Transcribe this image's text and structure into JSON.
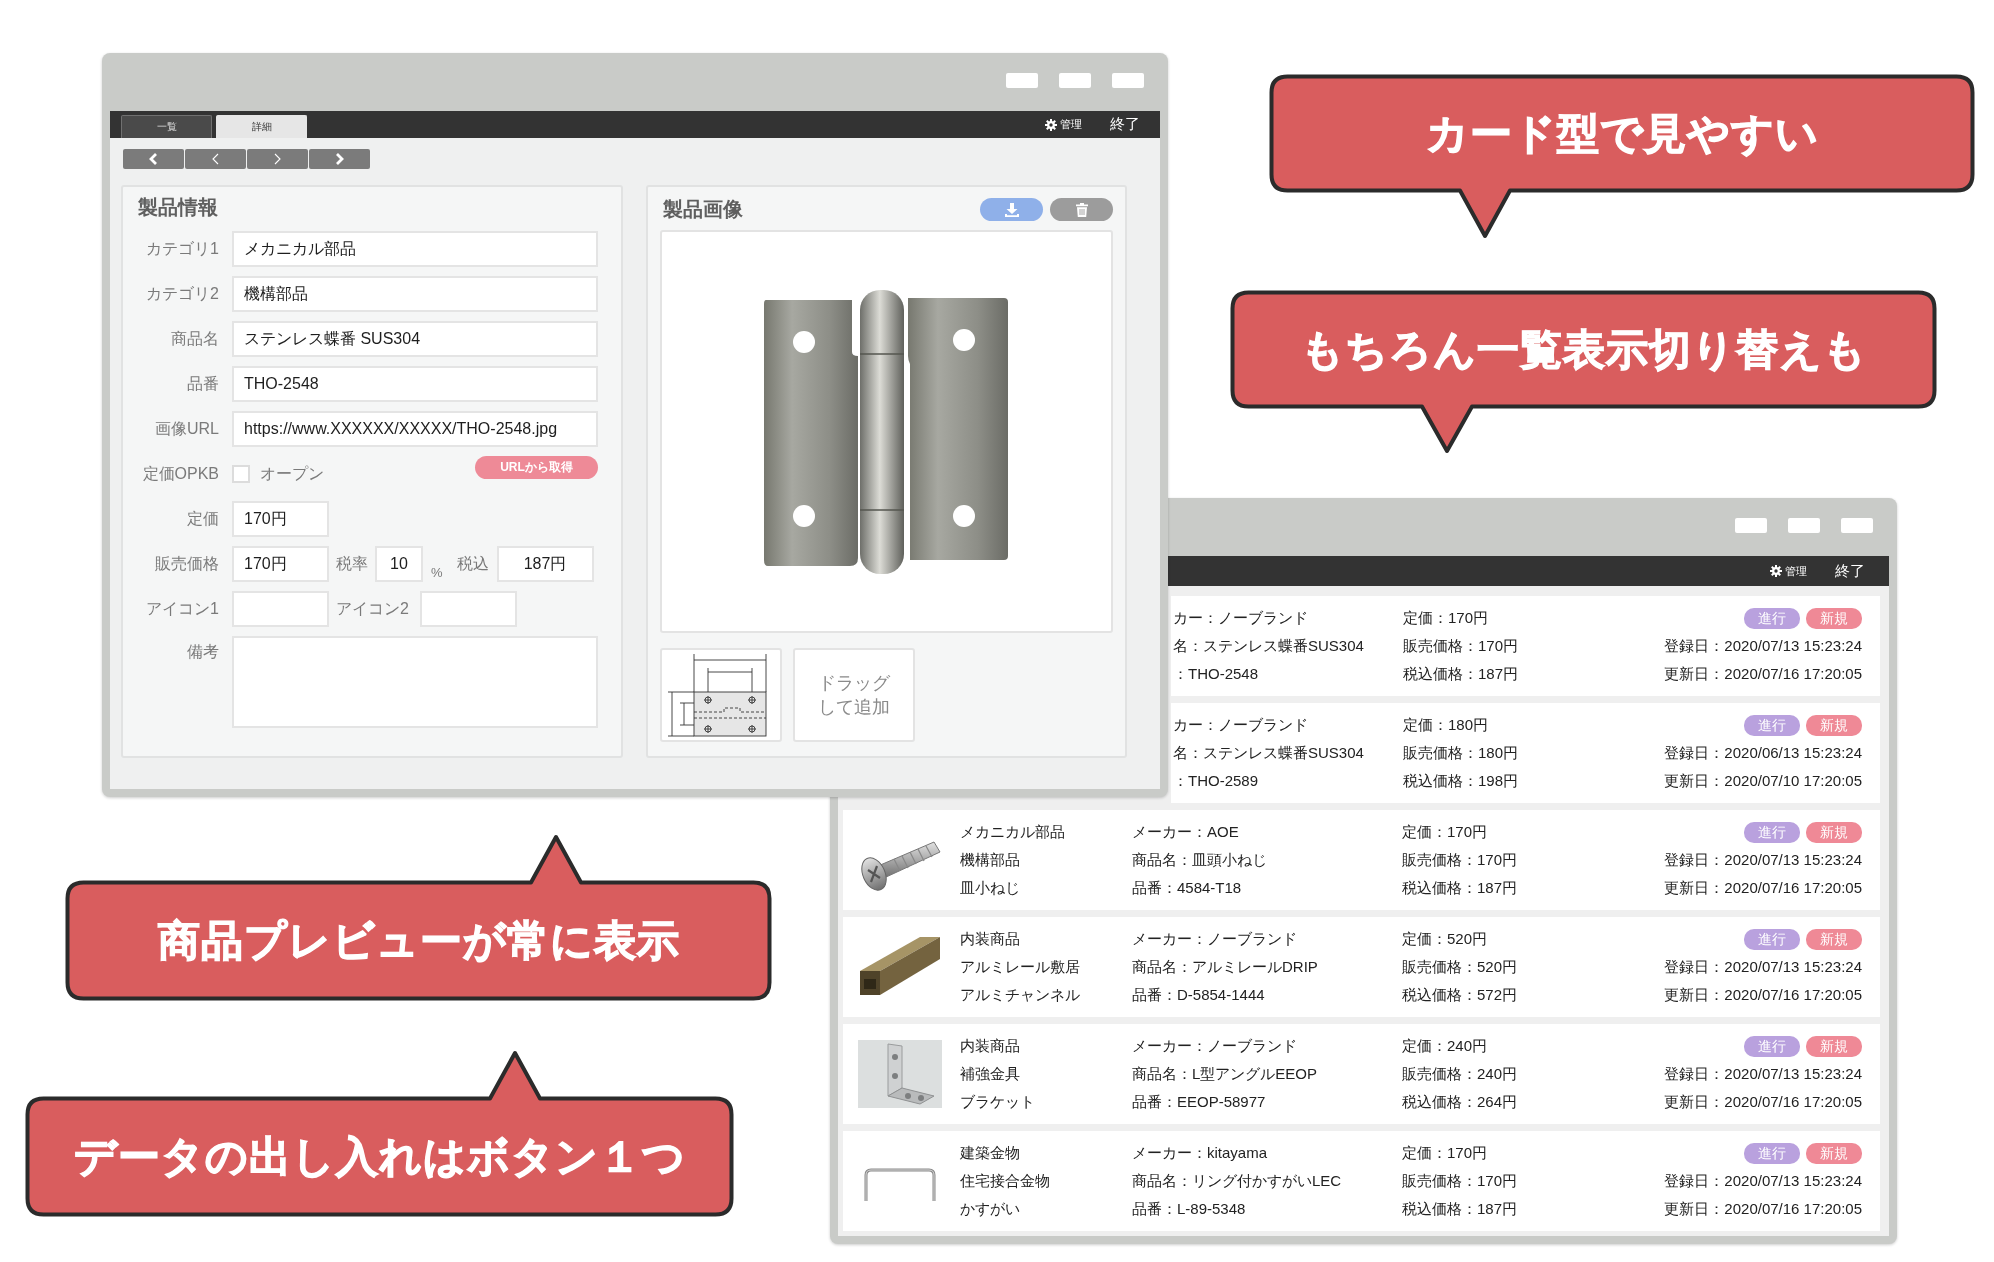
{
  "list_window": {
    "menu": {
      "settings": "管理",
      "exit": "終了"
    },
    "rows": [
      {
        "details": [
          "カー：ノーブランド",
          "名：ステンレス蝶番SUS304",
          "：THO-2548"
        ],
        "prices": [
          "定価：170円",
          "販売価格：170円",
          "税込価格：187円"
        ],
        "badges": [
          {
            "label": "進行",
            "color": "#b9a1de"
          },
          {
            "label": "新規",
            "color": "#ef8996"
          }
        ],
        "dates": [
          "登録日：2020/07/13 15:23:24",
          "更新日：2020/07/16 17:20:05"
        ]
      },
      {
        "details": [
          "カー：ノーブランド",
          "名：ステンレス蝶番SUS304",
          "：THO-2589"
        ],
        "prices": [
          "定価：180円",
          "販売価格：180円",
          "税込価格：198円"
        ],
        "badges": [
          {
            "label": "進行",
            "color": "#b9a1de"
          },
          {
            "label": "新規",
            "color": "#ef8996"
          }
        ],
        "dates": [
          "登録日：2020/06/13 15:23:24",
          "更新日：2020/07/10 17:20:05"
        ]
      },
      {
        "photo": {
          "kind": "screw"
        },
        "categories": [
          "メカニカル部品",
          "機構部品",
          "皿小ねじ"
        ],
        "details": [
          "メーカー：AOE",
          "商品名：皿頭小ねじ",
          "品番：4584-T18"
        ],
        "prices": [
          "定価：170円",
          "販売価格：170円",
          "税込価格：187円"
        ],
        "badges": [
          {
            "label": "進行",
            "color": "#b9a1de"
          },
          {
            "label": "新規",
            "color": "#ef8996"
          }
        ],
        "dates": [
          "登録日：2020/07/13 15:23:24",
          "更新日：2020/07/16 17:20:05"
        ]
      },
      {
        "photo": {
          "kind": "channel"
        },
        "categories": [
          "内装商品",
          "アルミレール敷居",
          "アルミチャンネル"
        ],
        "details": [
          "メーカー：ノーブランド",
          "商品名：アルミレールDRIP",
          "品番：D-5854-1444"
        ],
        "prices": [
          "定価：520円",
          "販売価格：520円",
          "税込価格：572円"
        ],
        "badges": [
          {
            "label": "進行",
            "color": "#b9a1de"
          },
          {
            "label": "新規",
            "color": "#ef8996"
          }
        ],
        "dates": [
          "登録日：2020/07/13 15:23:24",
          "更新日：2020/07/16 17:20:05"
        ]
      },
      {
        "photo": {
          "kind": "bracket"
        },
        "categories": [
          "内装商品",
          "補強金具",
          "ブラケット"
        ],
        "details": [
          "メーカー：ノーブランド",
          "商品名：L型アングルEEOP",
          "品番：EEOP-58977"
        ],
        "prices": [
          "定価：240円",
          "販売価格：240円",
          "税込価格：264円"
        ],
        "badges": [
          {
            "label": "進行",
            "color": "#b9a1de"
          },
          {
            "label": "新規",
            "color": "#ef8996"
          }
        ],
        "dates": [
          "登録日：2020/07/13 15:23:24",
          "更新日：2020/07/16 17:20:05"
        ]
      },
      {
        "photo": {
          "kind": "staple"
        },
        "categories": [
          "建築金物",
          "住宅接合金物",
          "かすがい"
        ],
        "details": [
          "メーカー：kitayama",
          "商品名：リング付かすがいLEC",
          "品番：L-89-5348"
        ],
        "prices": [
          "定価：170円",
          "販売価格：170円",
          "税込価格：187円"
        ],
        "badges": [
          {
            "label": "進行",
            "color": "#b9a1de"
          },
          {
            "label": "新規",
            "color": "#ef8996"
          }
        ],
        "dates": [
          "登録日：2020/07/13 15:23:24",
          "更新日：2020/07/16 17:20:05"
        ]
      }
    ]
  },
  "detail_window": {
    "tabs": [
      {
        "label": "一覧",
        "selected": false
      },
      {
        "label": "詳細",
        "selected": true
      }
    ],
    "menu": {
      "settings": "管理",
      "exit": "終了"
    },
    "product_info": {
      "title": "製品情報",
      "fields": [
        {
          "label": "カテゴリ1",
          "value": "メカニカル部品"
        },
        {
          "label": "カテゴリ2",
          "value": "機構部品"
        },
        {
          "label": "商品名",
          "value": "ステンレス蝶番 SUS304"
        },
        {
          "label": "品番",
          "value": "THO-2548"
        },
        {
          "label": "画像URL",
          "value": "https://www.XXXXXX/XXXXX/THO-2548.jpg"
        }
      ],
      "open_price": {
        "label": "定価OPKB",
        "option": "オープン",
        "checked": false
      },
      "fetch_button": "URLから取得",
      "list_price": {
        "label": "定価",
        "value": "170円"
      },
      "sale_price": {
        "label": "販売価格",
        "value": "170円"
      },
      "tax_rate": {
        "label": "税率",
        "value": "10",
        "unit": "%"
      },
      "tax_included": {
        "label": "税込",
        "value": "187円"
      },
      "icons": [
        {
          "label": "アイコン1"
        },
        {
          "label": "アイコン2"
        }
      ],
      "notes": {
        "label": "備考"
      }
    },
    "product_image": {
      "title": "製品画像",
      "drop_zone": "ドラッグして追加"
    }
  },
  "callouts": [
    "カード型で見やすい",
    "もちろん一覧表示切り替えも",
    "商品プレビューが常に表示",
    "データの出し入れはボタン１つ"
  ]
}
